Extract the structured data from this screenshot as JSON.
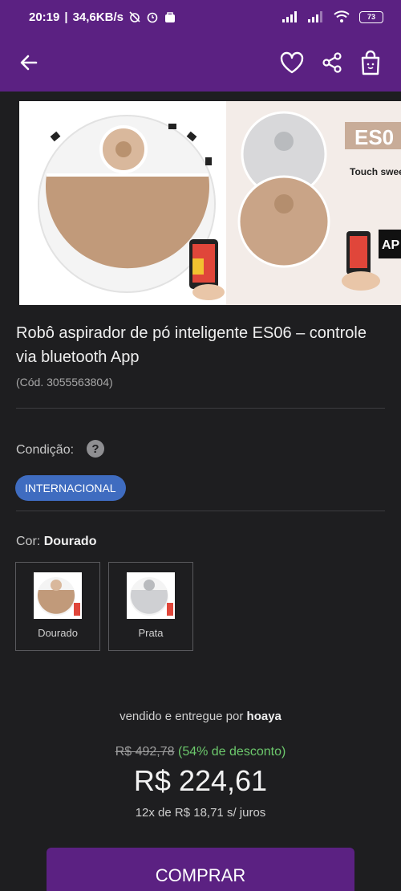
{
  "status_bar": {
    "time": "20:19",
    "speed": "34,6KB/s",
    "battery": "73",
    "icons": [
      "alarm-off-icon",
      "alarm-icon",
      "bag-icon",
      "signal-icon",
      "wifi-icon",
      "battery-icon"
    ]
  },
  "header": {
    "icons": [
      "back-arrow-icon",
      "heart-icon",
      "share-icon",
      "shopping-bag-icon"
    ]
  },
  "gallery": {
    "overlay_text": {
      "heading": "ES0",
      "subheading": "Touch swee",
      "badge": "AP"
    }
  },
  "product": {
    "title": "Robô aspirador de pó inteligente ES06 – controle via bluetooth App",
    "code": "(Cód. 3055563804)"
  },
  "condition": {
    "label": "Condição:",
    "value": "INTERNACIONAL"
  },
  "color": {
    "label": "Cor:",
    "selected": "Dourado",
    "options": [
      {
        "label": "Dourado",
        "swatch": "#c8a282"
      },
      {
        "label": "Prata",
        "swatch": "#cfd0d3"
      }
    ]
  },
  "sale": {
    "sold_by_prefix": "vendido e entregue por",
    "seller": "hoaya",
    "old_price": "R$ 492,78",
    "discount": "(54% de desconto)",
    "price": "R$ 224,61",
    "installments": "12x de R$ 18,71 s/ juros"
  },
  "buy_button": {
    "label": "COMPRAR"
  },
  "colors": {
    "brand_purple": "#5b2182",
    "chip_blue": "#3f6cc0",
    "discount_green": "#6cc86c",
    "background": "#1e1e20"
  }
}
